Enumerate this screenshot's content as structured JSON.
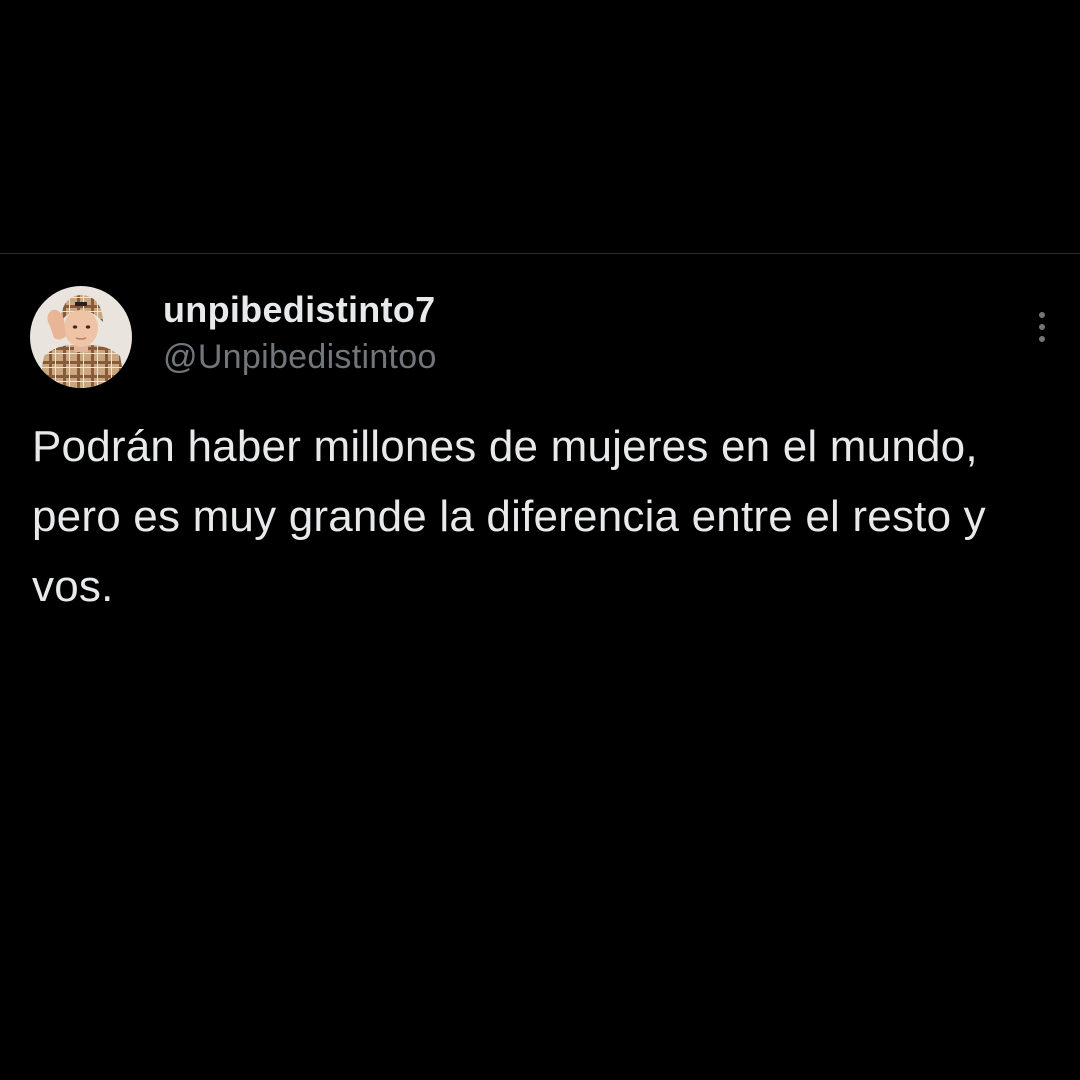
{
  "tweet": {
    "author": {
      "display_name": "unpibedistinto7",
      "handle": "@Unpibedistintoo",
      "avatar_icon": "user-avatar-photo"
    },
    "more_icon": "more-vertical-icon",
    "text": "Podrán haber millones de mujeres en el mundo, pero es muy grande la diferencia entre el resto y vos."
  },
  "colors": {
    "background": "#000000",
    "primary_text": "#e7e9ea",
    "secondary_text": "#71767b",
    "divider": "#2a2c2e"
  }
}
